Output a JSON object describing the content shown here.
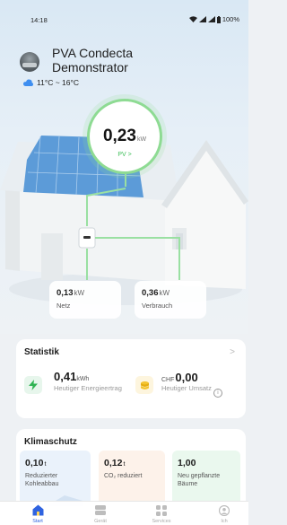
{
  "status_bar": {
    "time": "14:18",
    "battery": "100%"
  },
  "plant": {
    "name": "PVA Condecta Demonstrator"
  },
  "weather": {
    "temperature": "11°C ~ 16°C",
    "icon": "cloud-icon"
  },
  "pv": {
    "value": "0,23",
    "unit": "kW",
    "label": "PV >"
  },
  "flow": {
    "netz": {
      "value": "0,13",
      "unit": "kW",
      "label": "Netz"
    },
    "verbrauch": {
      "value": "0,36",
      "unit": "kW",
      "label": "Verbrauch"
    }
  },
  "statistik": {
    "title": "Statistik",
    "chevron": ">",
    "energy": {
      "value": "0,41",
      "unit": "kWh",
      "label": "Heutiger Energieertrag",
      "icon": "lightning-icon"
    },
    "revenue": {
      "currency": "CHF",
      "value": "0,00",
      "label": "Heutiger Umsatz",
      "icon": "coins-icon",
      "info": "i"
    }
  },
  "klimaschutz": {
    "title": "Klimaschutz",
    "tiles": [
      {
        "value": "0,10",
        "unit": "t",
        "label": "Reduzierter Kohleabbau",
        "color": "#eaf2fb"
      },
      {
        "value": "0,12",
        "unit": "t",
        "label": "CO₂ reduziert",
        "color": "#fdf2ea"
      },
      {
        "value": "1,00",
        "unit": "",
        "label": "Neu gepflanzte Bäume",
        "color": "#eaf8ee"
      }
    ]
  },
  "nav": {
    "items": [
      {
        "label": "Start",
        "icon": "home-icon",
        "active": true
      },
      {
        "label": "Gerät",
        "icon": "device-icon",
        "active": false
      },
      {
        "label": "Services",
        "icon": "services-icon",
        "active": false
      },
      {
        "label": "Ich",
        "icon": "profile-icon",
        "active": false
      }
    ]
  },
  "colors": {
    "accent": "#2f63e0",
    "pv_green": "#8edb93",
    "energy_green": "#3fbf5a",
    "coin_yellow": "#f4c430"
  }
}
